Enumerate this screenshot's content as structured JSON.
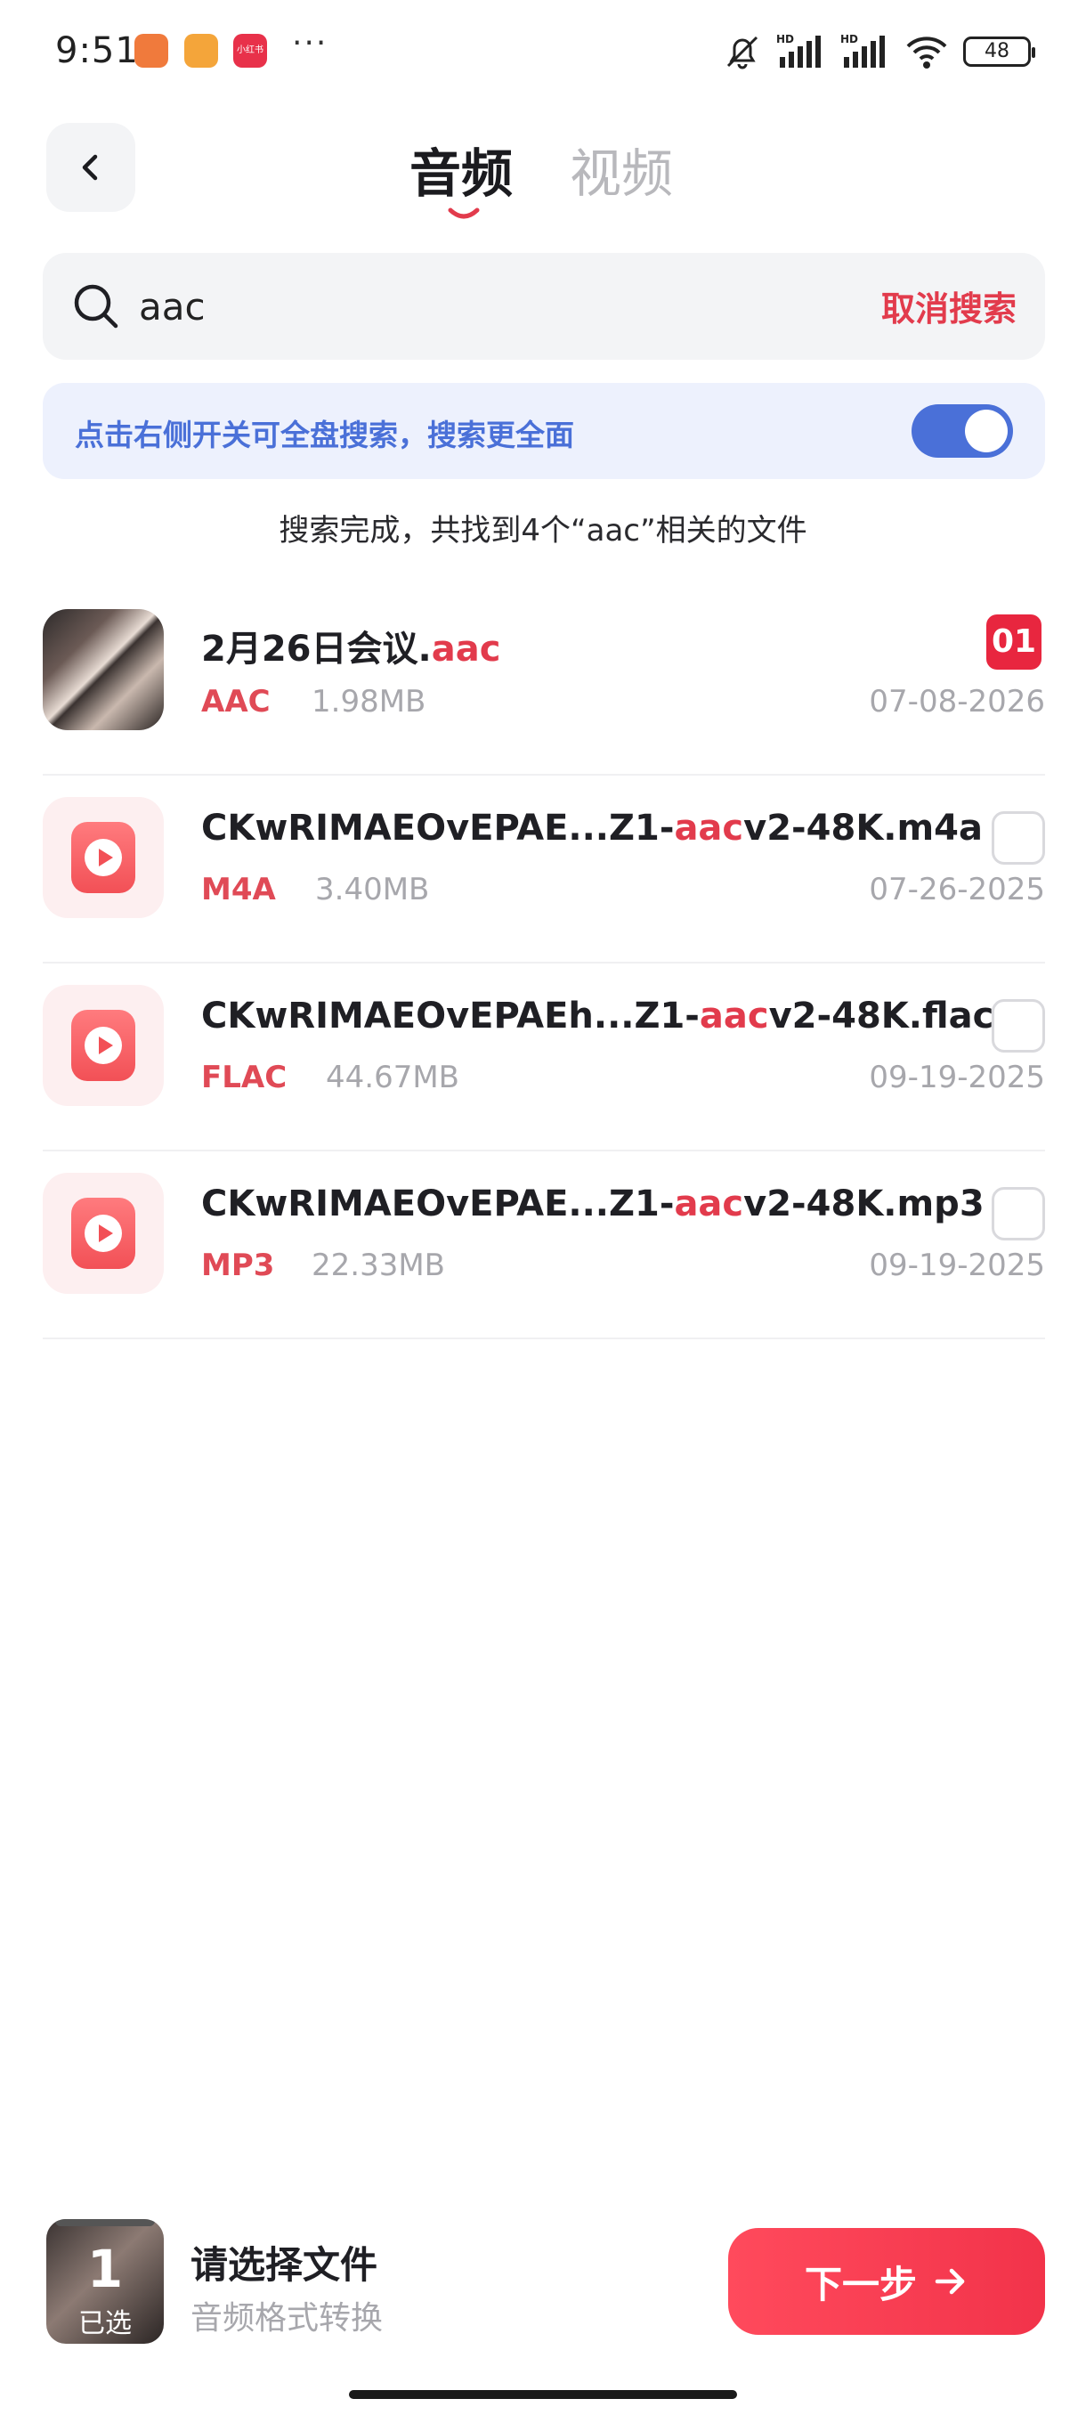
{
  "status_bar": {
    "time": "9:51",
    "app3_label": "小红书",
    "more": "···",
    "battery": "48"
  },
  "header": {
    "tabs": [
      {
        "label": "音频",
        "active": true
      },
      {
        "label": "视频",
        "active": false
      }
    ]
  },
  "search": {
    "value": "aac",
    "cancel_label": "取消搜索"
  },
  "banner": {
    "text": "点击右侧开关可全盘搜索，搜索更全面",
    "toggle_on": true
  },
  "result_summary": "搜索完成，共找到4个“aac”相关的文件",
  "files": [
    {
      "name_pre": "2月26日会议.",
      "name_hl": "aac",
      "name_post": "",
      "type": "AAC",
      "size": "1.98MB",
      "date": "07-08-2026",
      "selected_index": "01",
      "thumb": "photo"
    },
    {
      "name_pre": "CKwRIMAEOvEPAE...Z1-",
      "name_hl": "aac",
      "name_post": "v2-48K.m4a",
      "type": "M4A",
      "size": "3.40MB",
      "date": "07-26-2025",
      "selected_index": "",
      "thumb": "audio"
    },
    {
      "name_pre": "CKwRIMAEOvEPAEh...Z1-",
      "name_hl": "aac",
      "name_post": "v2-48K.flac",
      "type": "FLAC",
      "size": "44.67MB",
      "date": "09-19-2025",
      "selected_index": "",
      "thumb": "audio"
    },
    {
      "name_pre": "CKwRIMAEOvEPAE...Z1-",
      "name_hl": "aac",
      "name_post": "v2-48K.mp3",
      "type": "MP3",
      "size": "22.33MB",
      "date": "09-19-2025",
      "selected_index": "",
      "thumb": "audio"
    }
  ],
  "bottom": {
    "selected_count": "1",
    "selected_label": "已选",
    "prompt_title": "请选择文件",
    "prompt_sub": "音频格式转换",
    "next_label": "下一步"
  },
  "colors": {
    "accent": "#e23b4c",
    "banner_blue": "#4a70d8"
  }
}
